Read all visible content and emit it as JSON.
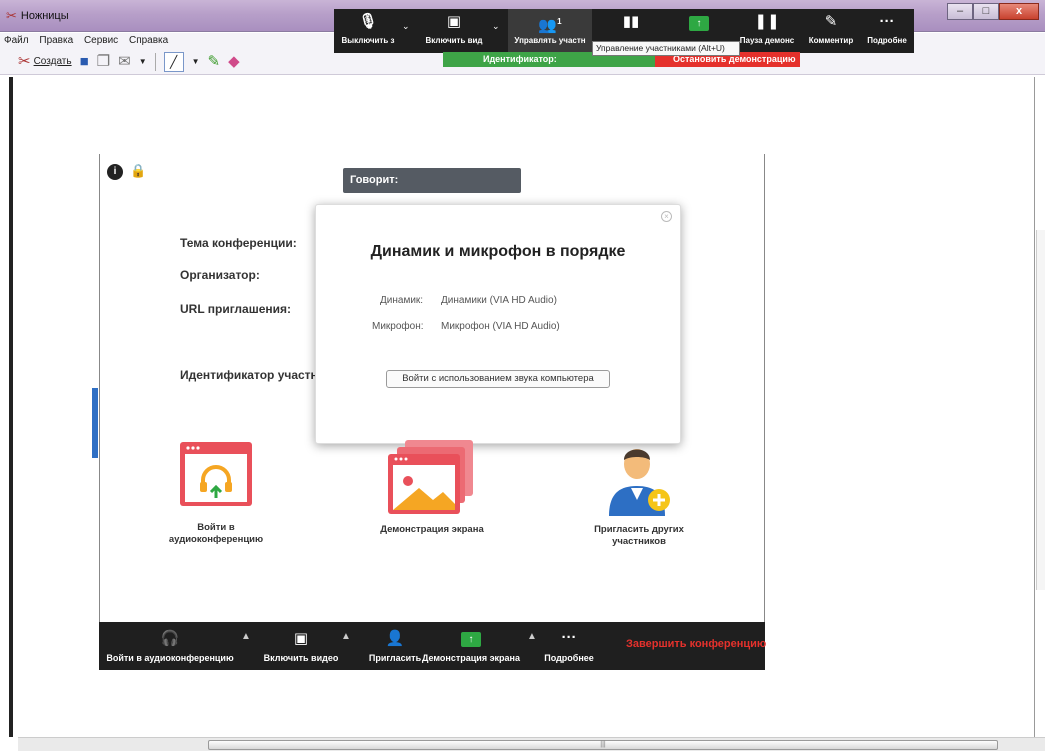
{
  "window": {
    "title": "Ножницы",
    "buttons": {
      "minimize": "–",
      "maximize": "□",
      "close": "x"
    }
  },
  "menubar": [
    "Файл",
    "Правка",
    "Сервис",
    "Справка"
  ],
  "toolbar": {
    "new_label": "Создать"
  },
  "zoom_topbar": {
    "items": [
      {
        "label": "Выключить з",
        "icon": "microphone-icon"
      },
      {
        "label": "Включить вид",
        "icon": "video-off-icon"
      },
      {
        "label": "Управлять участн",
        "icon": "participants-icon",
        "count": "1"
      },
      {
        "label": "",
        "icon": "polling-icon"
      },
      {
        "label": "",
        "icon": "share-screen-icon"
      },
      {
        "label": "Пауза демонс",
        "icon": "pause-icon"
      },
      {
        "label": "Комментир",
        "icon": "annotate-icon"
      },
      {
        "label": "Подробне",
        "icon": "more-icon"
      }
    ],
    "tooltip": "Управление участниками (Alt+U)",
    "id_bar": "Идентификатор:",
    "stop_share": "Остановить демонстрацию"
  },
  "speaking": "Говорит:",
  "meeting_info": {
    "topic_label": "Тема конференции:",
    "host_label": "Организатор:",
    "url_label": "URL приглашения:",
    "participant_id_label": "Идентификатор участни"
  },
  "audio_dialog": {
    "title": "Динамик и микрофон в порядке",
    "speaker_label": "Динамик:",
    "speaker_value": "Динамики (VIA HD Audio)",
    "mic_label": "Микрофон:",
    "mic_value": "Микрофон (VIA HD Audio)",
    "join_button": "Войти с использованием звука компьютера"
  },
  "tiles": [
    {
      "label_line1": "Войти в",
      "label_line2": "аудиоконференцию"
    },
    {
      "label_line1": "Демонстрация экрана",
      "label_line2": ""
    },
    {
      "label_line1": "Пригласить других",
      "label_line2": "участников"
    }
  ],
  "zoom_bottombar": {
    "join_audio": "Войти в аудиоконференцию",
    "start_video": "Включить видео",
    "invite": "Пригласить",
    "share_screen": "Демонстрация экрана",
    "more": "Подробнее",
    "end_meeting": "Завершить конференцию"
  },
  "colors": {
    "zoom_dark": "#1f1f1f",
    "zoom_green": "#2ea843",
    "zoom_red": "#e5312c",
    "tile_red": "#e9505a",
    "tile_orange": "#f5a623"
  }
}
